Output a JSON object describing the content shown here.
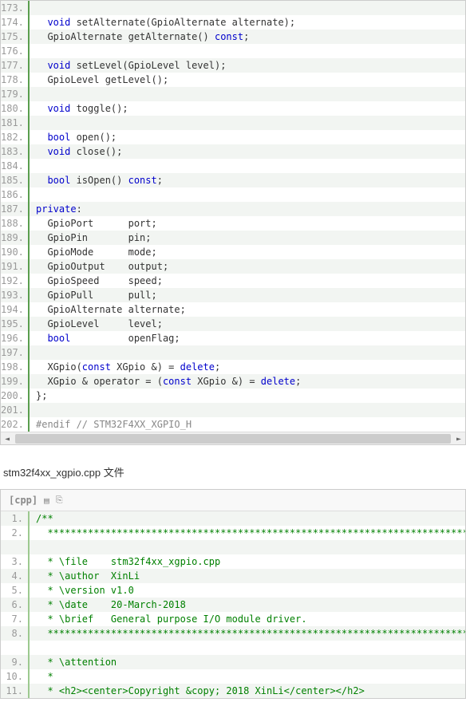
{
  "block1": {
    "lines": [
      {
        "n": 173,
        "t": []
      },
      {
        "n": 174,
        "t": [
          {
            "c": "",
            "v": "  "
          },
          {
            "c": "kw",
            "v": "void"
          },
          {
            "c": "",
            "v": " setAlternate(GpioAlternate alternate);"
          }
        ]
      },
      {
        "n": 175,
        "t": [
          {
            "c": "",
            "v": "  GpioAlternate getAlternate() "
          },
          {
            "c": "kw",
            "v": "const"
          },
          {
            "c": "",
            "v": ";"
          }
        ]
      },
      {
        "n": 176,
        "t": []
      },
      {
        "n": 177,
        "t": [
          {
            "c": "",
            "v": "  "
          },
          {
            "c": "kw",
            "v": "void"
          },
          {
            "c": "",
            "v": " setLevel(GpioLevel level);"
          }
        ]
      },
      {
        "n": 178,
        "t": [
          {
            "c": "",
            "v": "  GpioLevel getLevel();"
          }
        ]
      },
      {
        "n": 179,
        "t": []
      },
      {
        "n": 180,
        "t": [
          {
            "c": "",
            "v": "  "
          },
          {
            "c": "kw",
            "v": "void"
          },
          {
            "c": "",
            "v": " toggle();"
          }
        ]
      },
      {
        "n": 181,
        "t": []
      },
      {
        "n": 182,
        "t": [
          {
            "c": "",
            "v": "  "
          },
          {
            "c": "kw",
            "v": "bool"
          },
          {
            "c": "",
            "v": " open();"
          }
        ]
      },
      {
        "n": 183,
        "t": [
          {
            "c": "",
            "v": "  "
          },
          {
            "c": "kw",
            "v": "void"
          },
          {
            "c": "",
            "v": " close();"
          }
        ]
      },
      {
        "n": 184,
        "t": []
      },
      {
        "n": 185,
        "t": [
          {
            "c": "",
            "v": "  "
          },
          {
            "c": "kw",
            "v": "bool"
          },
          {
            "c": "",
            "v": " isOpen() "
          },
          {
            "c": "kw",
            "v": "const"
          },
          {
            "c": "",
            "v": ";"
          }
        ]
      },
      {
        "n": 186,
        "t": []
      },
      {
        "n": 187,
        "t": [
          {
            "c": "kw",
            "v": "private"
          },
          {
            "c": "",
            "v": ":"
          }
        ]
      },
      {
        "n": 188,
        "t": [
          {
            "c": "",
            "v": "  GpioPort      port;"
          }
        ]
      },
      {
        "n": 189,
        "t": [
          {
            "c": "",
            "v": "  GpioPin       pin;"
          }
        ]
      },
      {
        "n": 190,
        "t": [
          {
            "c": "",
            "v": "  GpioMode      mode;"
          }
        ]
      },
      {
        "n": 191,
        "t": [
          {
            "c": "",
            "v": "  GpioOutput    output;"
          }
        ]
      },
      {
        "n": 192,
        "t": [
          {
            "c": "",
            "v": "  GpioSpeed     speed;"
          }
        ]
      },
      {
        "n": 193,
        "t": [
          {
            "c": "",
            "v": "  GpioPull      pull;"
          }
        ]
      },
      {
        "n": 194,
        "t": [
          {
            "c": "",
            "v": "  GpioAlternate alternate;"
          }
        ]
      },
      {
        "n": 195,
        "t": [
          {
            "c": "",
            "v": "  GpioLevel     level;"
          }
        ]
      },
      {
        "n": 196,
        "t": [
          {
            "c": "",
            "v": "  "
          },
          {
            "c": "kw",
            "v": "bool"
          },
          {
            "c": "",
            "v": "          openFlag;"
          }
        ]
      },
      {
        "n": 197,
        "t": []
      },
      {
        "n": 198,
        "t": [
          {
            "c": "",
            "v": "  XGpio("
          },
          {
            "c": "kw",
            "v": "const"
          },
          {
            "c": "",
            "v": " XGpio &) = "
          },
          {
            "c": "kw",
            "v": "delete"
          },
          {
            "c": "",
            "v": ";"
          }
        ]
      },
      {
        "n": 199,
        "t": [
          {
            "c": "",
            "v": "  XGpio & operator = ("
          },
          {
            "c": "kw",
            "v": "const"
          },
          {
            "c": "",
            "v": " XGpio &) = "
          },
          {
            "c": "kw",
            "v": "delete"
          },
          {
            "c": "",
            "v": ";"
          }
        ]
      },
      {
        "n": 200,
        "t": [
          {
            "c": "",
            "v": "};"
          }
        ]
      },
      {
        "n": 201,
        "t": []
      },
      {
        "n": 202,
        "t": [
          {
            "c": "pp",
            "v": "#endif // STM32F4XX_XGPIO_H"
          }
        ]
      }
    ]
  },
  "header2": "stm32f4xx_xgpio.cpp 文件",
  "block2": {
    "toolbar": {
      "label": "[cpp]",
      "icon1": "view plain",
      "icon2": "copy"
    },
    "lines": [
      {
        "n": 1,
        "t": [
          {
            "c": "cm",
            "v": "/**"
          }
        ]
      },
      {
        "n": 2,
        "t": [
          {
            "c": "cm",
            "v": "  ******************************************************************************"
          }
        ]
      },
      {
        "n": 3,
        "t": [
          {
            "c": "cm",
            "v": "  * \\file    stm32f4xx_xgpio.cpp"
          }
        ]
      },
      {
        "n": 4,
        "t": [
          {
            "c": "cm",
            "v": "  * \\author  XinLi"
          }
        ]
      },
      {
        "n": 5,
        "t": [
          {
            "c": "cm",
            "v": "  * \\version v1.0"
          }
        ]
      },
      {
        "n": 6,
        "t": [
          {
            "c": "cm",
            "v": "  * \\date    20-March-2018"
          }
        ]
      },
      {
        "n": 7,
        "t": [
          {
            "c": "cm",
            "v": "  * \\brief   General purpose I/O module driver."
          }
        ]
      },
      {
        "n": 8,
        "t": [
          {
            "c": "cm",
            "v": "  ******************************************************************************"
          }
        ]
      },
      {
        "n": 9,
        "t": [
          {
            "c": "cm",
            "v": "  * \\attention"
          }
        ]
      },
      {
        "n": 10,
        "t": [
          {
            "c": "cm",
            "v": "  *"
          }
        ]
      },
      {
        "n": 11,
        "t": [
          {
            "c": "cm",
            "v": "  * <h2><center>Copyright &copy; 2018 XinLi</center></h2>"
          }
        ]
      }
    ]
  }
}
